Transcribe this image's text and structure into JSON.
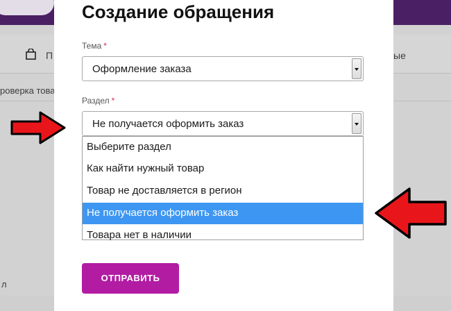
{
  "background": {
    "nav_label_left": "П",
    "nav_label_right": "ые",
    "breadcrumb": "роверка това",
    "footer_text": "л"
  },
  "modal": {
    "title": "Создание обращения",
    "topic": {
      "label": "Тема",
      "required_mark": "*",
      "value": "Оформление заказа"
    },
    "section": {
      "label": "Раздел",
      "required_mark": "*",
      "value": "Не получается оформить заказ",
      "options": [
        "Выберите раздел",
        "Как найти нужный товар",
        "Товар не доставляется в регион",
        "Не получается оформить заказ",
        "Товара нет в наличии"
      ],
      "highlighted_index": 3
    },
    "submit_label": "ОТПРАВИТЬ"
  },
  "colors": {
    "accent": "#b21ca3",
    "highlight": "#3d97f2",
    "required": "#e0274e",
    "arrow": "#e8161b"
  }
}
